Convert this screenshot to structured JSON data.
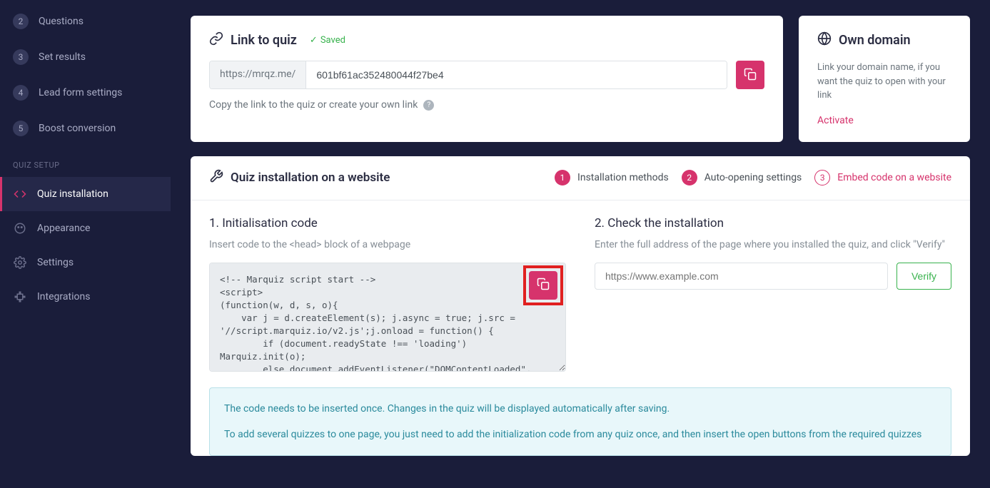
{
  "sidebar": {
    "steps": [
      {
        "n": "2",
        "label": "Questions"
      },
      {
        "n": "3",
        "label": "Set results"
      },
      {
        "n": "4",
        "label": "Lead form settings"
      },
      {
        "n": "5",
        "label": "Boost conversion"
      }
    ],
    "section_label": "QUIZ SETUP",
    "setup": [
      {
        "label": "Quiz installation",
        "active": true
      },
      {
        "label": "Appearance"
      },
      {
        "label": "Settings"
      },
      {
        "label": "Integrations"
      }
    ]
  },
  "link_card": {
    "title": "Link to quiz",
    "saved": "Saved",
    "prefix": "https://mrqz.me/",
    "value": "601bf61ac352480044f27be4",
    "copy_hint": "Copy the link to the quiz or create your own link"
  },
  "domain_card": {
    "title": "Own domain",
    "text": "Link your domain name, if you want the quiz to open with your link",
    "activate": "Activate"
  },
  "install": {
    "title": "Quiz installation on a website",
    "steps": [
      {
        "n": "1",
        "label": "Installation methods"
      },
      {
        "n": "2",
        "label": "Auto-opening settings"
      },
      {
        "n": "3",
        "label": "Embed code on a website"
      }
    ],
    "init": {
      "title": "1. Initialisation code",
      "hint": "Insert code to the <head> block of a webpage",
      "code": "<!-- Marquiz script start -->\n<script>\n(function(w, d, s, o){\n    var j = d.createElement(s); j.async = true; j.src = '//script.marquiz.io/v2.js';j.onload = function() {\n        if (document.readyState !== 'loading') Marquiz.init(o);\n        else document.addEventListener(\"DOMContentLoaded\", function() {\n            Marquiz.init(o);"
    },
    "check": {
      "title": "2. Check the installation",
      "hint": "Enter the full address of the page where you installed the quiz, and click \"Verify\"",
      "placeholder": "https://www.example.com",
      "verify": "Verify"
    },
    "notice1": "The code needs to be inserted once. Changes in the quiz will be displayed automatically after saving.",
    "notice2": "To add several quizzes to one page, you just need to add the initialization code from any quiz once, and then insert the open buttons from the required quizzes"
  }
}
